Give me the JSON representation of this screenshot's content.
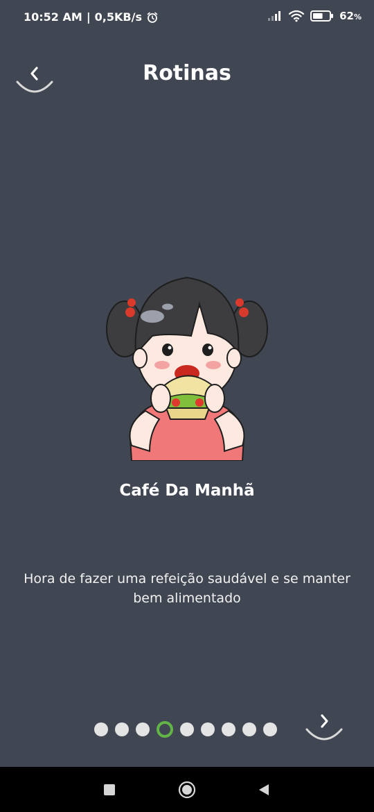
{
  "status_bar": {
    "time": "10:52 AM",
    "separator": "|",
    "speed": "0,5KB/s",
    "battery_percent": "62",
    "battery_unit": "%",
    "battery_level": 0.62,
    "icons": [
      "alarm-icon",
      "signal-icon",
      "wifi-icon",
      "battery-icon"
    ]
  },
  "header": {
    "title": "Rotinas",
    "back_icon": "chevron-left-icon"
  },
  "routine": {
    "illustration": "girl-eating-sandwich-illustration",
    "title": "Café Da Manhã",
    "description": "Hora de fazer uma refeição saudável e se manter bem alimentado"
  },
  "pagination": {
    "total": 9,
    "active_index": 3,
    "active_color": "#63b548",
    "next_icon": "chevron-right-icon"
  },
  "system_nav": {
    "icons": [
      "recents-square-icon",
      "home-circle-icon",
      "back-triangle-icon"
    ]
  },
  "colors": {
    "background": "#404652",
    "text": "#ffffff",
    "dot_inactive": "#e4e4e4"
  }
}
